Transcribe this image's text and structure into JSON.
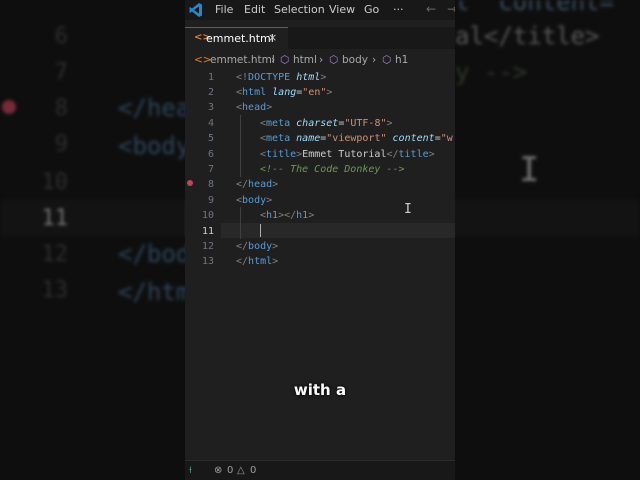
{
  "window": {
    "menu": [
      "File",
      "Edit",
      "Selection",
      "View",
      "Go"
    ],
    "more": "···",
    "nav_back": "←",
    "nav_forward": "→"
  },
  "tab": {
    "icon": "<>",
    "label": "emmet.html",
    "close": "×"
  },
  "breadcrumb": {
    "items": [
      "emmet.html",
      "html",
      "body",
      "h1"
    ],
    "separator": "›"
  },
  "editor": {
    "line_numbers": [
      "1",
      "2",
      "3",
      "4",
      "5",
      "6",
      "7",
      "8",
      "9",
      "10",
      "11",
      "12",
      "13"
    ],
    "current_line": "11",
    "lines": {
      "l1": {
        "open": "<!",
        "tag": "DOCTYPE",
        "attr": "html",
        "close": ">"
      },
      "l2": {
        "open": "<",
        "tag": "html",
        "attr": "lang",
        "eq": "=",
        "val": "\"en\"",
        "close": ">"
      },
      "l3": {
        "open": "<",
        "tag": "head",
        "close": ">"
      },
      "l4": {
        "open": "<",
        "tag": "meta",
        "attr": "charset",
        "eq": "=",
        "val": "\"UTF-8\"",
        "close": ">"
      },
      "l5": {
        "open": "<",
        "tag": "meta",
        "attr": "name",
        "eq": "=",
        "val": "\"viewport\"",
        "attr2": "content",
        "eq2": "=",
        "val2": "\"w"
      },
      "l6": {
        "open": "<",
        "tag": "title",
        "mid": ">",
        "text": "Emmet Tutorial",
        "close_open": "</",
        "tag2": "title",
        "close": ">"
      },
      "l7": {
        "comment": "<!-- The Code Donkey -->"
      },
      "l8": {
        "open": "</",
        "tag": "head",
        "close": ">"
      },
      "l9": {
        "open": "<",
        "tag": "body",
        "close": ">"
      },
      "l10": {
        "open": "<",
        "tag": "h1",
        "mid": "></",
        "tag2": "h1",
        "close": ">"
      },
      "l12": {
        "open": "</",
        "tag": "body",
        "close": ">"
      },
      "l13": {
        "open": "</",
        "tag": "html",
        "close": ">"
      }
    }
  },
  "caption": "with a",
  "statusbar": {
    "remote": "⟊",
    "errors": "0",
    "warnings": "0"
  },
  "background": {
    "numbers": [
      "6",
      "7",
      "8",
      "9",
      "10",
      "11",
      "12",
      "13"
    ],
    "frag_content": "t  content=\"",
    "frag_title": "al</title>",
    "frag_y": "y -->",
    "frag_head": "</head>",
    "frag_body": "<body>",
    "frag_body_close": "</body>",
    "frag_html": "</html>"
  },
  "colors": {
    "editor_bg": "#1f1f1f",
    "tag": "#569cd6",
    "attribute": "#9cdcfe",
    "string": "#ce9178",
    "comment": "#6a9955",
    "accent": "#0078d4",
    "breakpoint": "#c0455a"
  }
}
